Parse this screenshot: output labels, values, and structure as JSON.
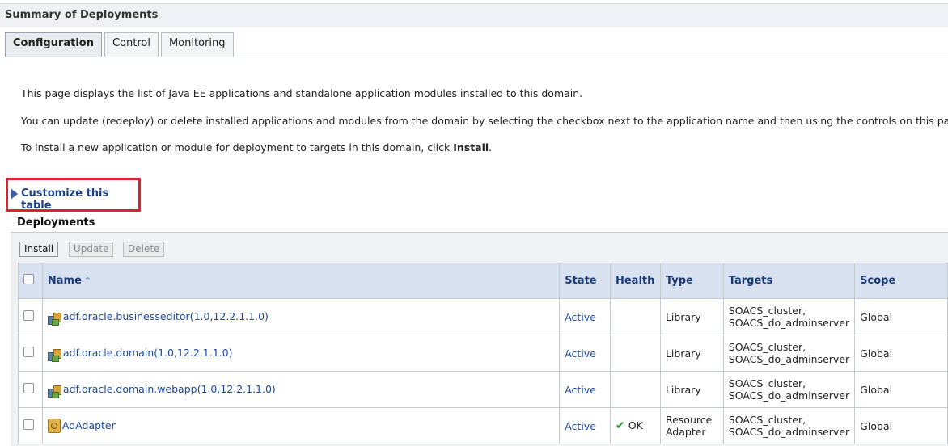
{
  "header": {
    "title": "Summary of Deployments"
  },
  "tabs": [
    {
      "label": "Configuration",
      "active": true
    },
    {
      "label": "Control",
      "active": false
    },
    {
      "label": "Monitoring",
      "active": false
    }
  ],
  "intro": {
    "line1": "This page displays the list of Java EE applications and standalone application modules installed to this domain.",
    "line2": "You can update (redeploy) or delete installed applications and modules from the domain by selecting the checkbox next to the application name and then using the controls on this page.",
    "line3_prefix": "To install a new application or module for deployment to targets in this domain, click ",
    "line3_bold": "Install",
    "line3_suffix": "."
  },
  "customize": {
    "label": "Customize this table"
  },
  "deployments": {
    "title": "Deployments",
    "buttons": {
      "install": "Install",
      "update": "Update",
      "delete": "Delete"
    },
    "columns": [
      "Name",
      "State",
      "Health",
      "Type",
      "Targets",
      "Scope"
    ],
    "rows": [
      {
        "name": "adf.oracle.businesseditor(1.0,12.2.1.1.0)",
        "icon": "library-icon",
        "state": "Active",
        "health": "",
        "type1": "Library",
        "type2": "",
        "target1": "SOACS_cluster,",
        "target2": "SOACS_do_adminserver",
        "scope": "Global"
      },
      {
        "name": "adf.oracle.domain(1.0,12.2.1.1.0)",
        "icon": "library-icon",
        "state": "Active",
        "health": "",
        "type1": "Library",
        "type2": "",
        "target1": "SOACS_cluster,",
        "target2": "SOACS_do_adminserver",
        "scope": "Global"
      },
      {
        "name": "adf.oracle.domain.webapp(1.0,12.2.1.1.0)",
        "icon": "library-icon",
        "state": "Active",
        "health": "",
        "type1": "Library",
        "type2": "",
        "target1": "SOACS_cluster,",
        "target2": "SOACS_do_adminserver",
        "scope": "Global"
      },
      {
        "name": "AqAdapter",
        "icon": "adapter-icon",
        "state": "Active",
        "health": "OK",
        "type1": "Resource",
        "type2": "Adapter",
        "target1": "SOACS_cluster,",
        "target2": "SOACS_do_adminserver",
        "scope": "Global"
      }
    ]
  },
  "colors": {
    "accent_red": "#e0202a",
    "link": "#1d4aa0",
    "header_bg": "#d7e1ef"
  }
}
